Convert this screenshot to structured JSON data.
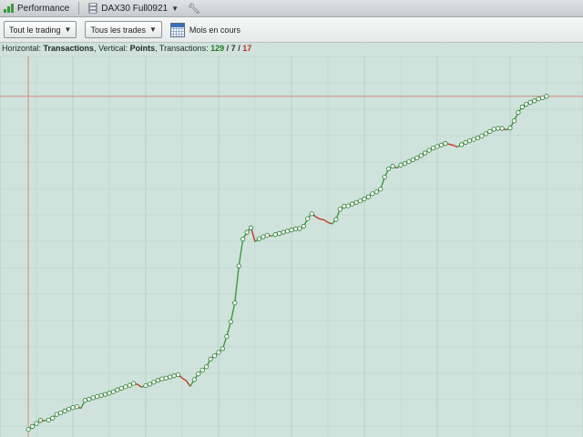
{
  "tabs": [
    {
      "label": "Performance",
      "icon": "bar-chart-icon"
    },
    {
      "label": "DAX30 Full0921",
      "icon": "instrument-icon"
    }
  ],
  "toolbar": {
    "scope_label": "Tout le trading",
    "trades_label": "Tous les trades",
    "period_label": "Mois en cours"
  },
  "legend": {
    "horizontal_prefix": "Horizontal: ",
    "horizontal_value": "Transactions",
    "vertical_prefix": ", Vertical: ",
    "vertical_value": "Points",
    "transactions_prefix": ", Transactions: ",
    "count_total": "129",
    "slash1": " / ",
    "count_neutral": "7",
    "slash2": " / ",
    "count_loss": "17"
  },
  "colors": {
    "background": "#cfe3dc",
    "grid": "#b2d2c7",
    "up_line": "#3d9a3d",
    "down_line": "#c0392b",
    "highwater": "#d48a80",
    "marker": "#2e7a2e"
  },
  "chart_data": {
    "type": "line",
    "title": "",
    "xlabel": "Transactions",
    "ylabel": "Points",
    "grid": true,
    "equity_curve_values": [
      0.0,
      0.8,
      1.6,
      2.4,
      2.3,
      2.5,
      3.0,
      4.0,
      4.4,
      4.9,
      5.4,
      5.8,
      6.0,
      5.6,
      7.7,
      8.0,
      8.4,
      8.7,
      9.0,
      9.3,
      9.6,
      10.0,
      10.5,
      10.9,
      11.3,
      11.7,
      12.2,
      11.9,
      11.2,
      11.6,
      12.0,
      12.5,
      13.0,
      13.4,
      13.6,
      13.9,
      14.2,
      14.5,
      13.6,
      12.9,
      11.4,
      13.2,
      14.7,
      15.7,
      16.6,
      18.6,
      19.5,
      20.4,
      21.4,
      24.6,
      28.5,
      33.5,
      43.3,
      50.4,
      52.2,
      53.4,
      49.7,
      50.5,
      51.0,
      51.4,
      51.2,
      51.6,
      51.9,
      52.2,
      52.5,
      52.8,
      53.1,
      53.2,
      53.8,
      55.8,
      57.1,
      56.3,
      55.7,
      55.5,
      54.8,
      54.4,
      55.6,
      58.3,
      59.1,
      59.2,
      59.7,
      60.1,
      60.5,
      61.0,
      61.6,
      62.4,
      62.9,
      63.6,
      66.8,
      69.0,
      69.7,
      69.2,
      70.0,
      70.4,
      70.9,
      71.4,
      71.9,
      72.5,
      73.2,
      73.9,
      74.5,
      74.9,
      75.3,
      75.7,
      75.5,
      75.2,
      74.8,
      75.4,
      76.0,
      76.4,
      76.8,
      77.2,
      77.7,
      78.3,
      78.9,
      79.5,
      79.7,
      79.7,
      79.3,
      79.8,
      81.7,
      83.9,
      85.4,
      86.1,
      86.6,
      87.0,
      87.5,
      87.8,
      88.2
    ],
    "high_water_mark": 88.2,
    "ylim": [
      -2,
      92
    ],
    "xlim": [
      -7,
      137
    ]
  }
}
